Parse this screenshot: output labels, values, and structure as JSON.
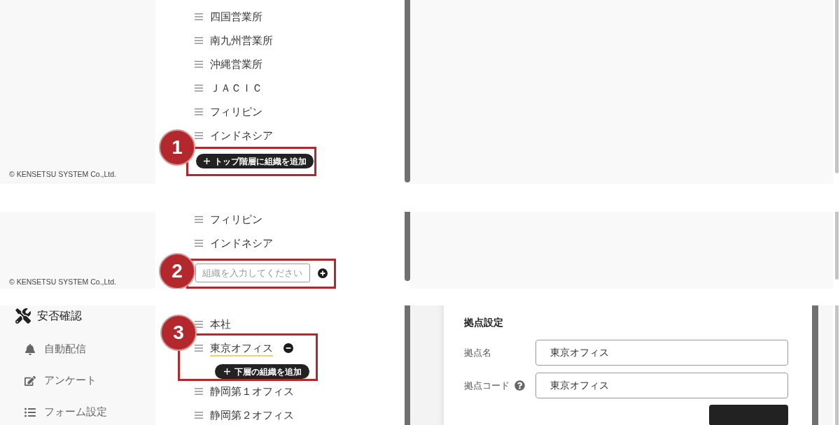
{
  "panels": [
    {
      "kind": "tree_with_button",
      "callout": {
        "number": "1"
      },
      "footer": "© KENSETSU SYSTEM Co.,Ltd.",
      "tree": [
        {
          "label": "四国営業所",
          "selected": false
        },
        {
          "label": "南九州営業所",
          "selected": false
        },
        {
          "label": "沖縄営業所",
          "selected": false
        },
        {
          "label": "ＪＡＣＩＣ",
          "selected": false
        },
        {
          "label": "フィリピン",
          "selected": false
        },
        {
          "label": "インドネシア",
          "selected": false
        }
      ],
      "add_top_button": {
        "label": "トップ階層に組織を追加"
      }
    },
    {
      "kind": "tree_with_input",
      "callout": {
        "number": "2"
      },
      "footer": "© KENSETSU SYSTEM Co.,Ltd.",
      "tree": [
        {
          "label": "フィリピン",
          "selected": false
        },
        {
          "label": "インドネシア",
          "selected": false
        }
      ],
      "org_input": {
        "placeholder": "組織を入力してください"
      }
    },
    {
      "kind": "tree_with_detail",
      "callout": {
        "number": "3"
      },
      "sidebar_menu": [
        {
          "kind": "section",
          "label": "安否確認"
        },
        {
          "kind": "item",
          "label": "自動配信"
        },
        {
          "kind": "item",
          "label": "アンケート"
        },
        {
          "kind": "item",
          "label": "フォーム設定"
        }
      ],
      "tree": [
        {
          "label": "本社",
          "selected": false
        },
        {
          "label": "東京オフィス",
          "selected": true
        },
        {
          "label": "静岡第１オフィス",
          "selected": false
        },
        {
          "label": "静岡第２オフィス",
          "selected": false
        }
      ],
      "add_child_button": {
        "label": "下層の組織を追加"
      },
      "settings_card": {
        "title": "拠点設定",
        "fields": [
          {
            "label": "拠点名",
            "value": "東京オフィス",
            "help": false
          },
          {
            "label": "拠点コード",
            "value": "東京オフィス",
            "help": true
          }
        ]
      }
    }
  ]
}
